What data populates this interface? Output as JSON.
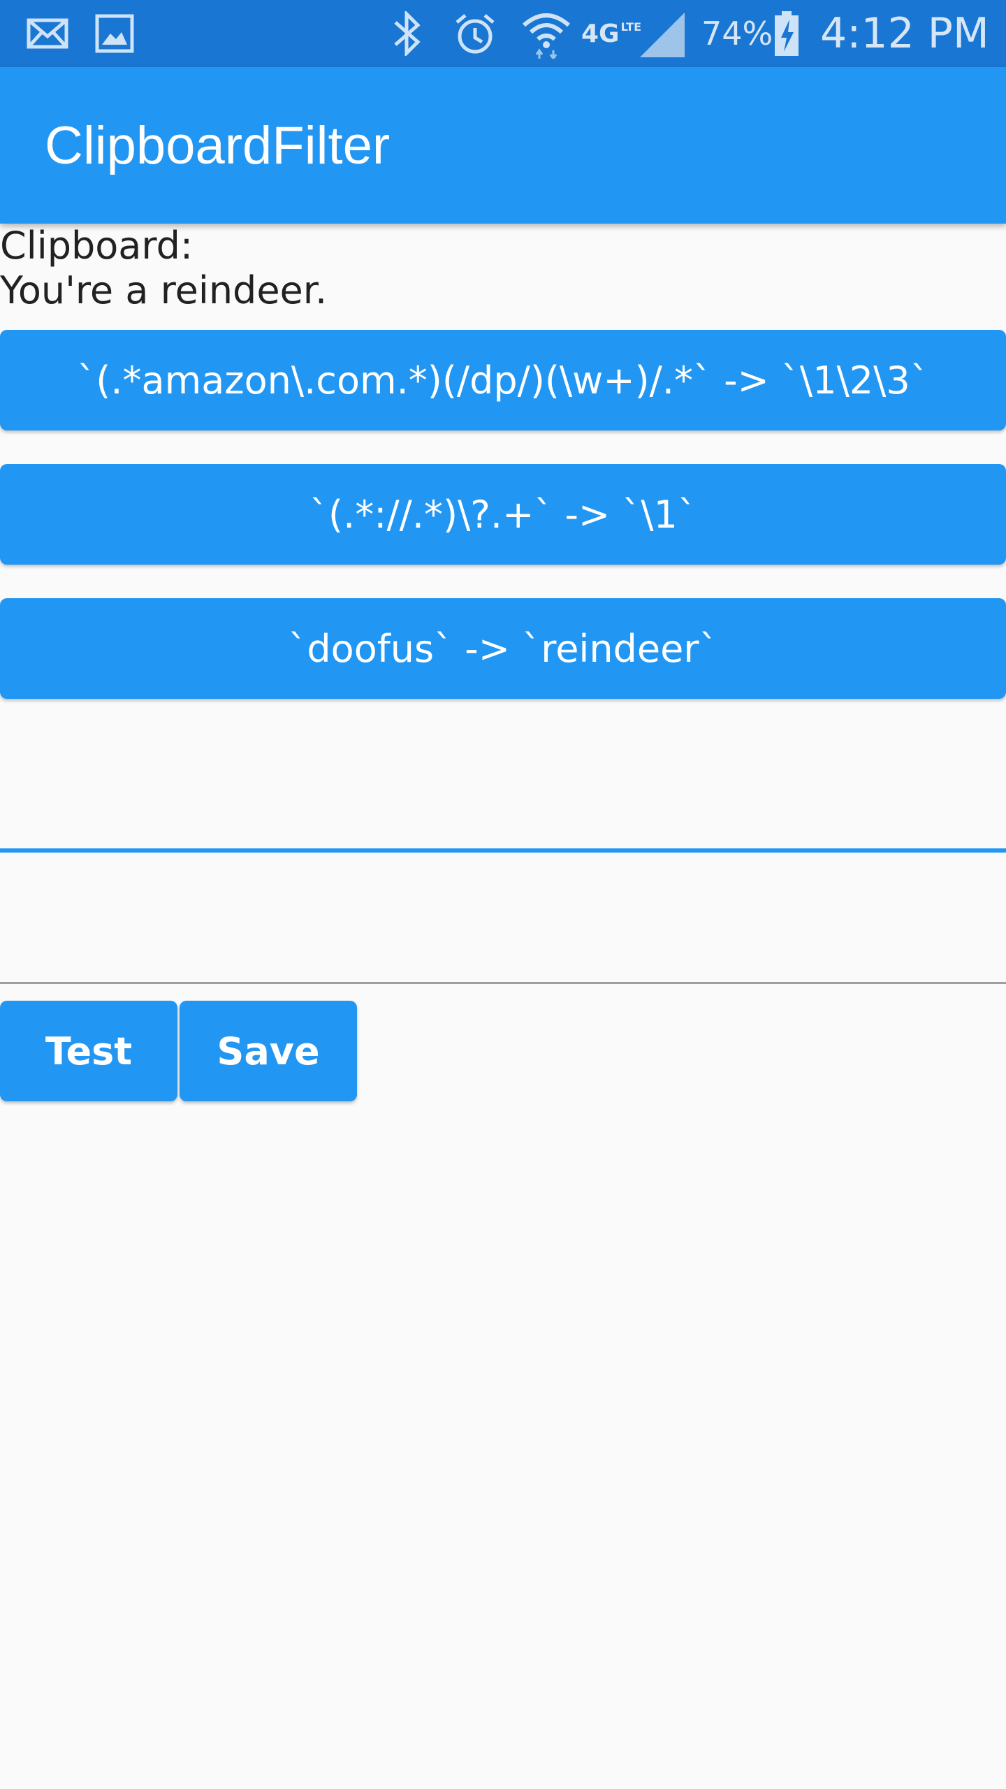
{
  "status_bar": {
    "icons_left": [
      "mail-icon",
      "image-icon"
    ],
    "icons_right": [
      "bluetooth-icon",
      "alarm-icon",
      "wifi-icon",
      "signal-icon",
      "battery-charging-icon"
    ],
    "network": "4G",
    "network_sub": "LTE",
    "battery": "74%",
    "time": "4:12 PM",
    "background_color": "#1976d2"
  },
  "app_bar": {
    "title": "ClipboardFilter",
    "color": "#2196f3"
  },
  "clipboard": {
    "label": "Clipboard:",
    "value": "You're a reindeer."
  },
  "filters": [
    {
      "label": "`(.*amazon\\.com.*)(/dp/)(\\w+)/.*` -> `\\1\\2\\3`"
    },
    {
      "label": "`(.*://.*)\\?.+` -> `\\1`"
    },
    {
      "label": "`doofus` -> `reindeer`"
    }
  ],
  "inputs": {
    "pattern_value": "",
    "replacement_value": ""
  },
  "actions": {
    "test_label": "Test",
    "save_label": "Save"
  }
}
